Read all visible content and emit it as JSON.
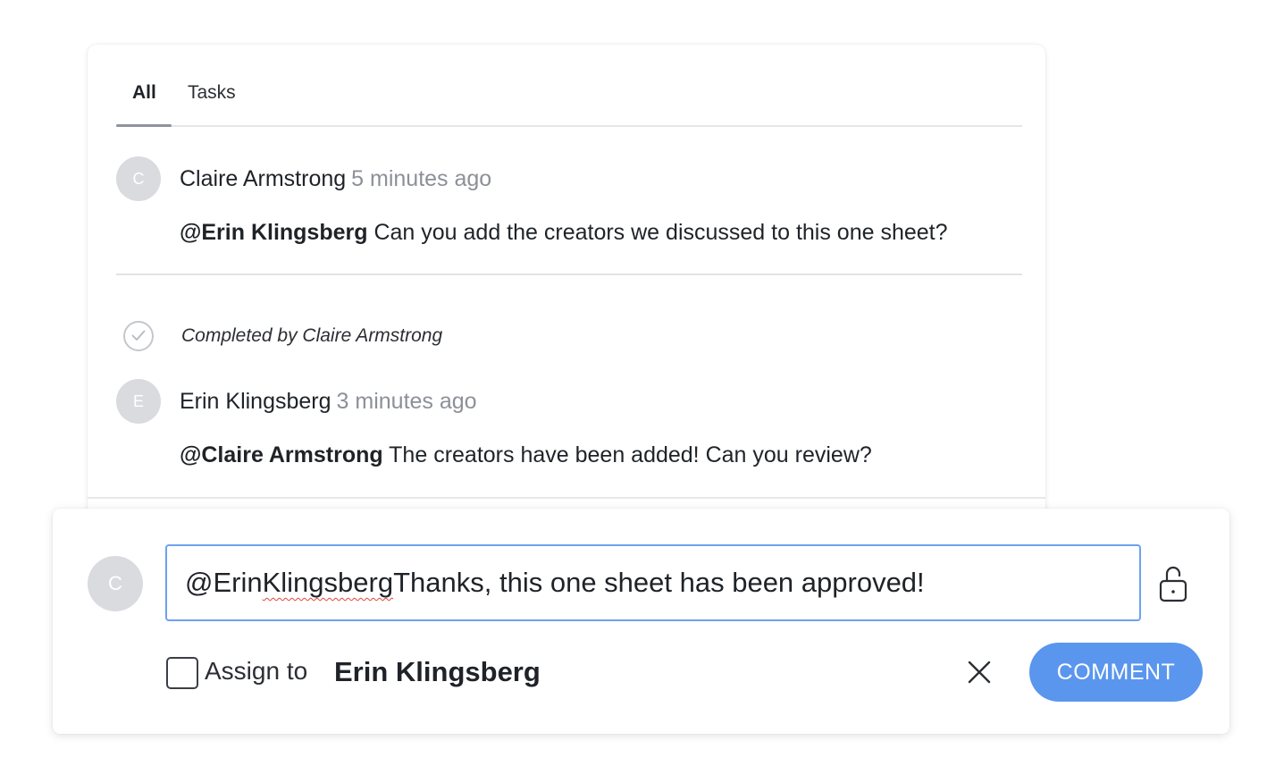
{
  "tabs": [
    {
      "label": "All",
      "active": true
    },
    {
      "label": "Tasks",
      "active": false
    }
  ],
  "comments": [
    {
      "avatar_initial": "C",
      "author": "Claire Armstrong",
      "time": "5 minutes ago",
      "mention": "@Erin Klingsberg",
      "text": " Can you add the creators we discussed to this one sheet?"
    },
    {
      "avatar_initial": "E",
      "author": "Erin Klingsberg",
      "time": "3 minutes ago",
      "mention": "@Claire Armstrong",
      "text": " The creators have been added! Can you review?"
    }
  ],
  "task_status": {
    "text": "Completed by Claire Armstrong",
    "icon": "check-circle-icon"
  },
  "composer": {
    "avatar_initial": "C",
    "input_mention_first": "@Erin ",
    "input_mention_last": "Klingsberg",
    "input_text": " Thanks, this one sheet has been approved!",
    "lock_icon": "unlock-icon",
    "assign_label": "Assign to",
    "assignee": "Erin Klingsberg",
    "close_icon": "close-icon",
    "submit_label": "COMMENT"
  },
  "colors": {
    "accent": "#5a96ee",
    "input_border": "#6da1f2",
    "muted_text": "#8c9097",
    "avatar_bg": "#d9dbde"
  }
}
